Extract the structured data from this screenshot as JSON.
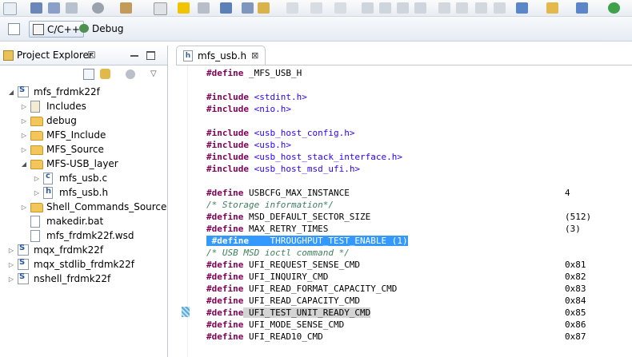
{
  "perspectives": [
    {
      "label": "C/C++"
    },
    {
      "label": "Debug"
    }
  ],
  "explorer": {
    "title": "Project Explorer",
    "close": "☒",
    "tree": [
      {
        "label": "mfs_frdmk22f",
        "depth": 0,
        "expanded": true,
        "icon": "project"
      },
      {
        "label": "Includes",
        "depth": 1,
        "expanded": false,
        "icon": "includes"
      },
      {
        "label": "debug",
        "depth": 1,
        "expanded": false,
        "icon": "folder"
      },
      {
        "label": "MFS_Include",
        "depth": 1,
        "expanded": false,
        "icon": "folder"
      },
      {
        "label": "MFS_Source",
        "depth": 1,
        "expanded": false,
        "icon": "folder"
      },
      {
        "label": "MFS-USB_layer",
        "depth": 1,
        "expanded": true,
        "icon": "folder"
      },
      {
        "label": "mfs_usb.c",
        "depth": 2,
        "expanded": false,
        "icon": "c-file"
      },
      {
        "label": "mfs_usb.h",
        "depth": 2,
        "expanded": false,
        "icon": "h-file"
      },
      {
        "label": "Shell_Commands_Source",
        "depth": 1,
        "expanded": false,
        "icon": "folder"
      },
      {
        "label": "makedir.bat",
        "depth": 1,
        "expanded": null,
        "icon": "file"
      },
      {
        "label": "mfs_frdmk22f.wsd",
        "depth": 1,
        "expanded": null,
        "icon": "file"
      },
      {
        "label": "mqx_frdmk22f",
        "depth": 0,
        "expanded": false,
        "icon": "project"
      },
      {
        "label": "mqx_stdlib_frdmk22f",
        "depth": 0,
        "expanded": false,
        "icon": "project"
      },
      {
        "label": "nshell_frdmk22f",
        "depth": 0,
        "expanded": false,
        "icon": "project"
      }
    ]
  },
  "editor": {
    "tab_label": "mfs_usb.h",
    "tab_close": "⊠",
    "lines": [
      {
        "kw": "#define",
        "rest": " _MFS_USB_H",
        "value": ""
      },
      {
        "kw": "",
        "rest": "",
        "value": ""
      },
      {
        "kw": "#include",
        "rest": " <stdint.h>",
        "value": "",
        "str": true
      },
      {
        "kw": "#include",
        "rest": " <nio.h>",
        "value": "",
        "str": true
      },
      {
        "kw": "",
        "rest": "",
        "value": ""
      },
      {
        "kw": "#include",
        "rest": " <usb_host_config.h>",
        "value": "",
        "str": true
      },
      {
        "kw": "#include",
        "rest": " <usb.h>",
        "value": "",
        "str": true
      },
      {
        "kw": "#include",
        "rest": " <usb_host_stack_interface.h>",
        "value": "",
        "str": true
      },
      {
        "kw": "#include",
        "rest": " <usb_host_msd_ufi.h>",
        "value": "",
        "str": true
      },
      {
        "kw": "",
        "rest": "",
        "value": ""
      },
      {
        "kw": "#define",
        "rest": " USBCFG_MAX_INSTANCE",
        "value": "4"
      },
      {
        "kw": "",
        "rest": "/* Storage information*/",
        "value": "",
        "comment": true
      },
      {
        "kw": "#define",
        "rest": " MSD_DEFAULT_SECTOR_SIZE",
        "value": "(512)"
      },
      {
        "kw": "#define",
        "rest": " MAX_RETRY_TIMES",
        "value": "(3)"
      },
      {
        "kw": " #define",
        "rest": "    THROUGHPUT_TEST_ENABLE (1)",
        "value": "",
        "highlight": true
      },
      {
        "kw": "",
        "rest": "/* USB MSD ioctl command */",
        "value": "",
        "comment": true
      },
      {
        "kw": "#define",
        "rest": " UFI_REQUEST_SENSE_CMD",
        "value": "0x81"
      },
      {
        "kw": "#define",
        "rest": " UFI_INQUIRY_CMD",
        "value": "0x82"
      },
      {
        "kw": "#define",
        "rest": " UFI_READ_FORMAT_CAPACITY_CMD",
        "value": "0x83"
      },
      {
        "kw": "#define",
        "rest": " UFI_READ_CAPACITY_CMD",
        "value": "0x84"
      },
      {
        "kw": "#define",
        "rest": " UFI_TEST_UNIT_READY_CMD",
        "value": "0x85",
        "occurrence": true
      },
      {
        "kw": "#define",
        "rest": " UFI_MODE_SENSE_CMD",
        "value": "0x86"
      },
      {
        "kw": "#define",
        "rest": " UFI_READ10_CMD",
        "value": "0x87"
      }
    ]
  }
}
